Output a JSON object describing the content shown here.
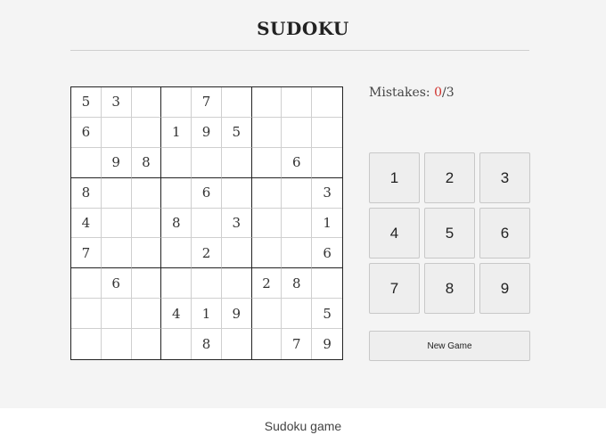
{
  "title": "SUDOKU",
  "mistakes": {
    "label": "Mistakes: ",
    "count": "0",
    "separator": "/",
    "max": "3"
  },
  "board": [
    [
      "5",
      "3",
      "",
      "",
      "7",
      "",
      "",
      "",
      ""
    ],
    [
      "6",
      "",
      "",
      "1",
      "9",
      "5",
      "",
      "",
      ""
    ],
    [
      "",
      "9",
      "8",
      "",
      "",
      "",
      "",
      "6",
      ""
    ],
    [
      "8",
      "",
      "",
      "",
      "6",
      "",
      "",
      "",
      "3"
    ],
    [
      "4",
      "",
      "",
      "8",
      "",
      "3",
      "",
      "",
      "1"
    ],
    [
      "7",
      "",
      "",
      "",
      "2",
      "",
      "",
      "",
      "6"
    ],
    [
      "",
      "6",
      "",
      "",
      "",
      "",
      "2",
      "8",
      ""
    ],
    [
      "",
      "",
      "",
      "4",
      "1",
      "9",
      "",
      "",
      "5"
    ],
    [
      "",
      "",
      "",
      "",
      "8",
      "",
      "",
      "7",
      "9"
    ]
  ],
  "numpad": [
    "1",
    "2",
    "3",
    "4",
    "5",
    "6",
    "7",
    "8",
    "9"
  ],
  "new_game_label": "New Game",
  "caption": "Sudoku game",
  "colors": {
    "mistake_count": "#d0312d"
  }
}
